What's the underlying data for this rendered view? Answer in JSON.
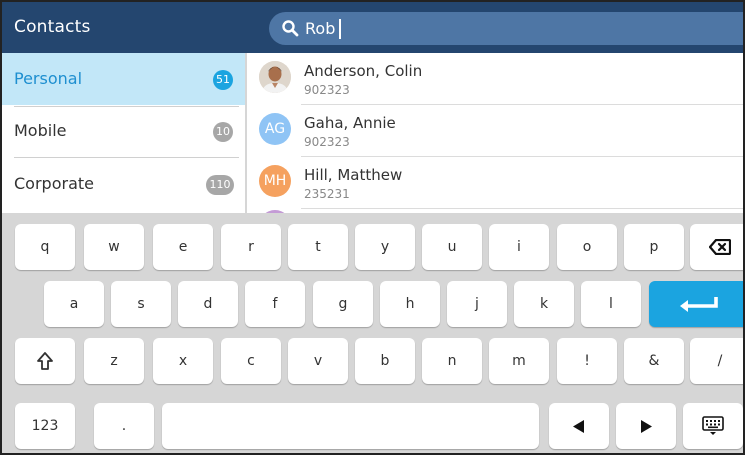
{
  "header": {
    "title": "Contacts",
    "search_value": "Rob",
    "search_icon": "search-icon"
  },
  "sidebar": {
    "items": [
      {
        "label": "Personal",
        "count": "51",
        "active": true,
        "badge_color": "#1ba4e0"
      },
      {
        "label": "Mobile",
        "count": "10",
        "active": false,
        "badge_color": "#a7a7a7"
      },
      {
        "label": "Corporate",
        "count": "110",
        "active": false,
        "badge_color": "#a7a7a7"
      }
    ]
  },
  "contacts": [
    {
      "name": "Anderson, Colin",
      "number": "902323",
      "initials": "",
      "avatar": "photo"
    },
    {
      "name": "Gaha, Annie",
      "number": "902323",
      "initials": "AG",
      "avatar_color": "#8fc4f5"
    },
    {
      "name": "Hill, Matthew",
      "number": "235231",
      "initials": "MH",
      "avatar_color": "#f5a15f"
    }
  ],
  "keyboard": {
    "row1": [
      "q",
      "w",
      "e",
      "r",
      "t",
      "y",
      "u",
      "i",
      "o",
      "p"
    ],
    "row2": [
      "a",
      "s",
      "d",
      "f",
      "g",
      "h",
      "j",
      "k",
      "l"
    ],
    "row3": [
      "z",
      "x",
      "c",
      "v",
      "b",
      "n",
      "m",
      "!",
      "&",
      "/"
    ],
    "numbers_label": "123",
    "period_label": ".",
    "icons": {
      "backspace": "backspace-icon",
      "enter": "enter-icon",
      "shift": "shift-icon",
      "left": "arrow-left-icon",
      "right": "arrow-right-icon",
      "hide": "keyboard-hide-icon"
    }
  },
  "colors": {
    "header_bg": "#24466f",
    "search_bg": "#4e76a5",
    "selected_bg": "#c2e7f8",
    "accent": "#1ba4e0",
    "keyboard_bg": "#d6d6d6"
  }
}
